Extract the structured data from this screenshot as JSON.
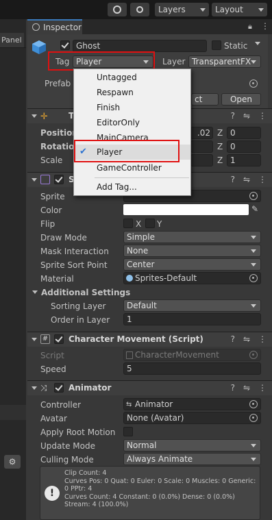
{
  "toolbar": {
    "layers_label": "Layers",
    "layout_label": "Layout"
  },
  "left_panel": {
    "tab_label": "Panel"
  },
  "inspector": {
    "tab_label": "Inspector",
    "object_name": "Ghost",
    "static_label": "Static",
    "tag_label": "Tag",
    "tag_value": "Player",
    "layer_label": "Layer",
    "layer_value": "TransparentFX",
    "prefab_label": "Prefab",
    "prefab_select_partial": "ct",
    "prefab_open": "Open"
  },
  "tag_menu": {
    "items": [
      "Untagged",
      "Respawn",
      "Finish",
      "EditorOnly",
      "MainCamera",
      "Player",
      "GameController"
    ],
    "selected": "Player",
    "add_tag": "Add Tag..."
  },
  "transform": {
    "title_partial": "T",
    "position_label": "Position",
    "rotation_label": "Rotation",
    "scale_label": "Scale",
    "position_y_partial": ".02",
    "z_label": "Z",
    "position_z": "0",
    "rotation_z": "0",
    "scale_z": "1"
  },
  "sprite_renderer": {
    "title_partial": "S",
    "sprite_label": "Sprite",
    "color_label": "Color",
    "flip_label": "Flip",
    "flip_x": "X",
    "flip_y": "Y",
    "draw_mode_label": "Draw Mode",
    "draw_mode_value": "Simple",
    "mask_label": "Mask Interaction",
    "mask_value": "None",
    "sort_point_label": "Sprite Sort Point",
    "sort_point_value": "Center",
    "material_label": "Material",
    "material_value": "Sprites-Default",
    "additional_label": "Additional Settings",
    "sorting_layer_label": "Sorting Layer",
    "sorting_layer_value": "Default",
    "order_label": "Order in Layer",
    "order_value": "1"
  },
  "character_movement": {
    "title": "Character Movement (Script)",
    "script_label": "Script",
    "script_value": "CharacterMovement",
    "speed_label": "Speed",
    "speed_value": "5"
  },
  "animator": {
    "title": "Animator",
    "controller_label": "Controller",
    "controller_value": "Animator",
    "avatar_label": "Avatar",
    "avatar_value": "None (Avatar)",
    "root_motion_label": "Apply Root Motion",
    "update_mode_label": "Update Mode",
    "update_mode_value": "Normal",
    "culling_label": "Culling Mode",
    "culling_value": "Always Animate",
    "info_text": "Clip Count: 4\nCurves Pos: 0 Quat: 0 Euler: 0 Scale: 0 Muscles: 0 Generic: 0 PPtr: 4\nCurves Count: 4 Constant: 0 (0.0%) Dense: 0 (0.0%) Stream: 4 (100.0%)"
  },
  "colors": {
    "highlight_red": "#e01010",
    "tab_accent": "#3a79bb",
    "checkmark_blue": "#2f74d0"
  }
}
